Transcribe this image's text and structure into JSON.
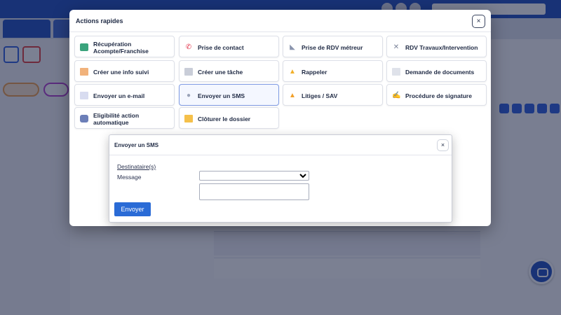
{
  "colors": {
    "brand": "#1f4fbf",
    "accent": "#2a6bd6",
    "overlay": "rgba(20,28,60,0.56)"
  },
  "modal": {
    "title": "Actions rapides",
    "close_glyph": "×",
    "actions": [
      {
        "label": "Récupération Acompte/Franchise",
        "icon": "money-card-icon"
      },
      {
        "label": "Prise de contact",
        "icon": "phone-icon"
      },
      {
        "label": "Prise de RDV métreur",
        "icon": "ruler-icon"
      },
      {
        "label": "RDV Travaux/Intervention",
        "icon": "tools-icon"
      },
      {
        "label": "Créer une info suivi",
        "icon": "note-icon"
      },
      {
        "label": "Créer une tâche",
        "icon": "clipboard-icon"
      },
      {
        "label": "Rappeler",
        "icon": "bell-icon"
      },
      {
        "label": "Demande de documents",
        "icon": "document-icon"
      },
      {
        "label": "Envoyer un e-mail",
        "icon": "envelope-icon"
      },
      {
        "label": "Envoyer un SMS",
        "icon": "speech-bubble-icon"
      },
      {
        "label": "Litiges / SAV",
        "icon": "warning-icon"
      },
      {
        "label": "Procédure de signature",
        "icon": "signature-pen-icon"
      },
      {
        "label": "Eligibilité action automatique",
        "icon": "robot-icon"
      },
      {
        "label": "Clôturer le dossier",
        "icon": "folder-icon"
      }
    ]
  },
  "sms_dialog": {
    "title": "Envoyer un SMS",
    "close_glyph": "×",
    "recipients_link": "Destinataire(s)",
    "message_label": "Message",
    "select_value": "",
    "message_value": "",
    "send_label": "Envoyer"
  }
}
